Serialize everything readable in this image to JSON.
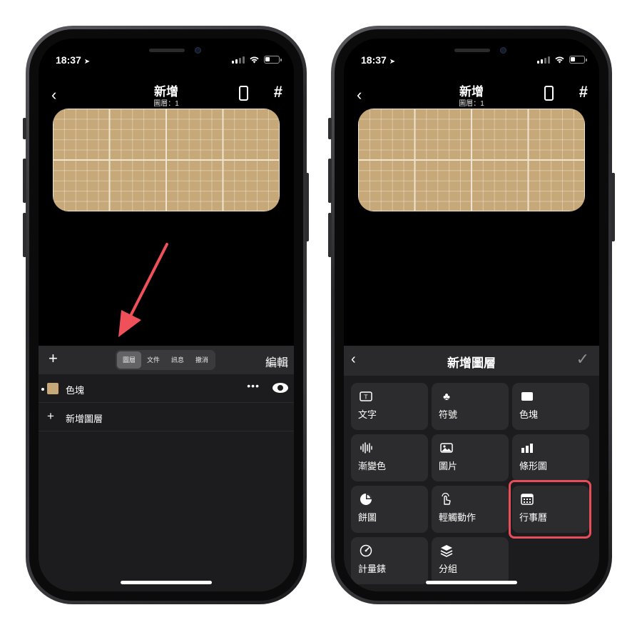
{
  "left_phone": {
    "status": {
      "time": "18:37",
      "location_glyph": "➤"
    },
    "nav": {
      "title": "新增",
      "subtitle": "圖層：1"
    },
    "toolbar": {
      "segments": [
        "圖層",
        "文件",
        "訊息",
        "撤消"
      ],
      "active_segment": "圖層",
      "edit_label": "編輯"
    },
    "layers": [
      {
        "name": "色塊",
        "color": "#c7a878"
      }
    ],
    "add_layer_label": "新增圖層",
    "annotation": {
      "arrow_color": "#f0505a"
    }
  },
  "right_phone": {
    "status": {
      "time": "18:37",
      "location_glyph": "➤"
    },
    "nav": {
      "title": "新增",
      "subtitle": "圖層：1"
    },
    "sheet": {
      "title": "新增圖層",
      "items": [
        {
          "label": "文字",
          "icon": "text-box-icon"
        },
        {
          "label": "符號",
          "icon": "club-symbol-icon"
        },
        {
          "label": "色塊",
          "icon": "color-block-icon"
        },
        {
          "label": "漸變色",
          "icon": "gradient-wave-icon"
        },
        {
          "label": "圖片",
          "icon": "image-icon"
        },
        {
          "label": "條形圖",
          "icon": "bar-chart-icon"
        },
        {
          "label": "餅圖",
          "icon": "pie-chart-icon"
        },
        {
          "label": "輕觸動作",
          "icon": "tap-gesture-icon"
        },
        {
          "label": "行事曆",
          "icon": "calendar-icon"
        },
        {
          "label": "計量錶",
          "icon": "gauge-icon"
        },
        {
          "label": "分組",
          "icon": "layers-icon"
        }
      ],
      "highlighted_item": "行事曆",
      "highlight_color": "#e84d5a"
    }
  },
  "colors": {
    "widget": "#c7a878",
    "background": "#000000",
    "panel": "#1c1c1e"
  }
}
